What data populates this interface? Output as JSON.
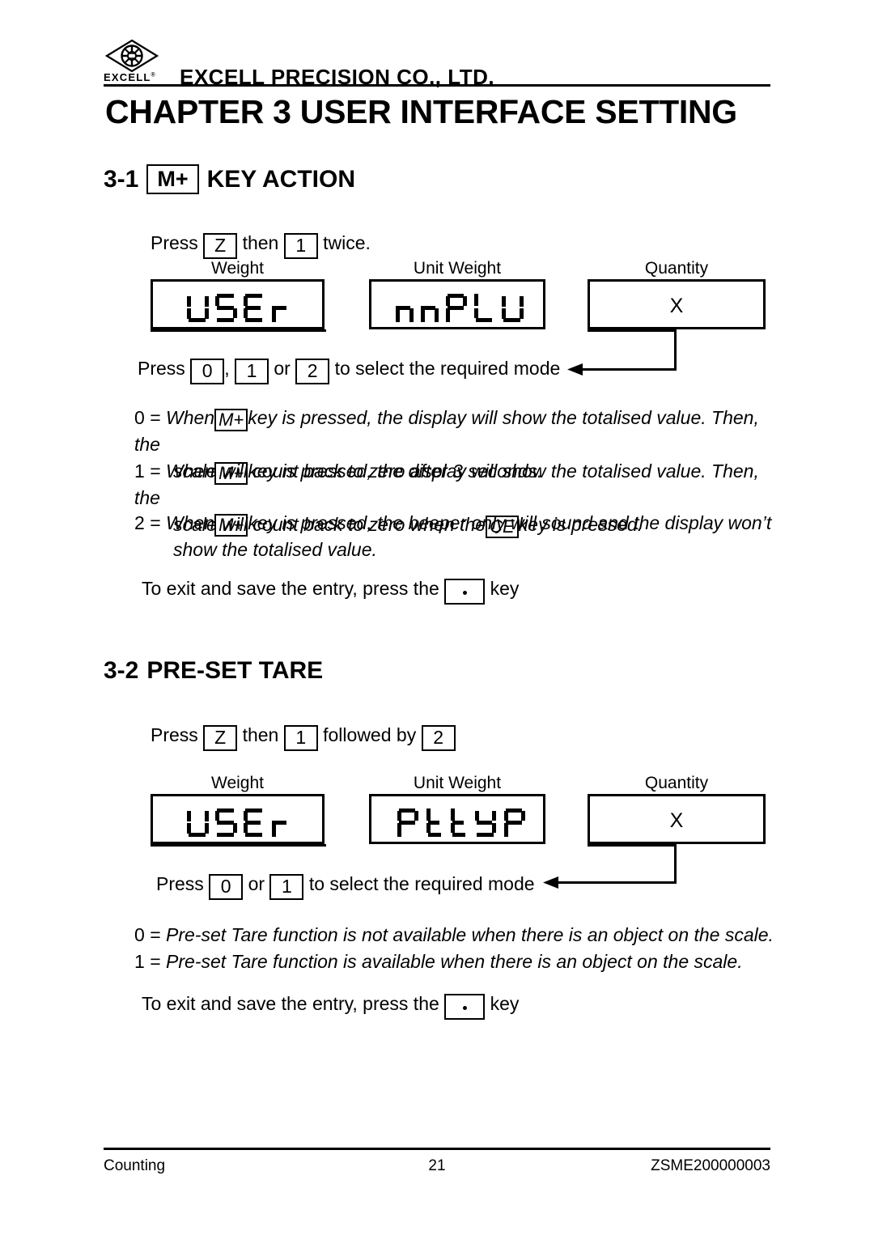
{
  "header": {
    "logo_icon": "excell-diamond-logo",
    "logo_word": "EXCELL",
    "logo_registered": "®",
    "company": "EXCELL PRECISION CO., LTD."
  },
  "chapter_title": "CHAPTER 3 USER INTERFACE SETTING",
  "section_31": {
    "number": "3-1",
    "key": "M+",
    "title": "KEY ACTION",
    "press_line": {
      "press": "Press",
      "key1": "Z",
      "then": "then",
      "key2": "1",
      "tail": "twice."
    },
    "displays": {
      "weight_caption": "Weight",
      "unit_weight_caption": "Unit Weight",
      "quantity_caption": "Quantity",
      "weight_value": "USEr",
      "unit_weight_value": "nnPLU",
      "quantity_value": "X"
    },
    "select_line": {
      "press": "Press",
      "key1": "0",
      "comma": ",",
      "key2": "1",
      "or": "or",
      "key3": "2",
      "tail": "to select the required mode"
    },
    "modes": [
      {
        "num": "0",
        "eq": "=",
        "pre": "When",
        "key": "M+",
        "post": "key is pressed, the display will show the totalised value. Then, the",
        "line2_pre": "scale will count back to zero after 3 seconds.",
        "line2_key": "",
        "line2_post": ""
      },
      {
        "num": "1",
        "eq": "=",
        "pre": "When",
        "key": "M+",
        "post": "key is pressed, the display will show the totalised value. Then, the",
        "line2_pre": "scale will count back to zero when the",
        "line2_key": "CE",
        "line2_post": "key is pressed."
      },
      {
        "num": "2",
        "eq": "=",
        "pre": "When",
        "key": "M+",
        "post": "key is pressed, the beeper only will sound and the display won’t",
        "line2_pre": "show the totalised value.",
        "line2_key": "",
        "line2_post": ""
      }
    ],
    "exit_line": {
      "pre": "To exit and save the entry, press the",
      "key": "·",
      "post": "key"
    }
  },
  "section_32": {
    "number": "3-2",
    "title": "PRE-SET TARE",
    "press_line": {
      "press": "Press",
      "key1": "Z",
      "then": "then",
      "key2": "1",
      "followed": "followed by",
      "key3": "2"
    },
    "displays": {
      "weight_caption": "Weight",
      "unit_weight_caption": "Unit Weight",
      "quantity_caption": "Quantity",
      "weight_value": "USEr",
      "unit_weight_value": "PttYP",
      "quantity_value": "X"
    },
    "select_line": {
      "press": "Press",
      "key1": "0",
      "or": "or",
      "key2": "1",
      "tail": "to select the required mode"
    },
    "modes": [
      {
        "num": "0",
        "eq": "=",
        "text": "Pre-set Tare function is not available when there is an object on the scale."
      },
      {
        "num": "1",
        "eq": "=",
        "text": "Pre-set Tare function is available when there is an object on the scale."
      }
    ],
    "exit_line": {
      "pre": "To exit and save the entry, press the",
      "key": "·",
      "post": "key"
    }
  },
  "footer": {
    "left": "Counting",
    "center": "21",
    "right": "ZSME200000003"
  }
}
